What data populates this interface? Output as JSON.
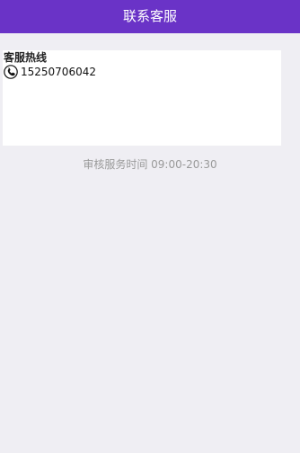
{
  "header": {
    "title": "联系客服"
  },
  "card": {
    "title": "客服热线",
    "phone_icon": "phone-icon",
    "phone_number": "15250706042"
  },
  "footer": {
    "service_hours": "审核服务时间 09:00-20:30"
  },
  "colors": {
    "header_bg": "#6a33c7",
    "page_bg": "#efeef3",
    "card_bg": "#ffffff",
    "muted_text": "#9a9a9a"
  }
}
